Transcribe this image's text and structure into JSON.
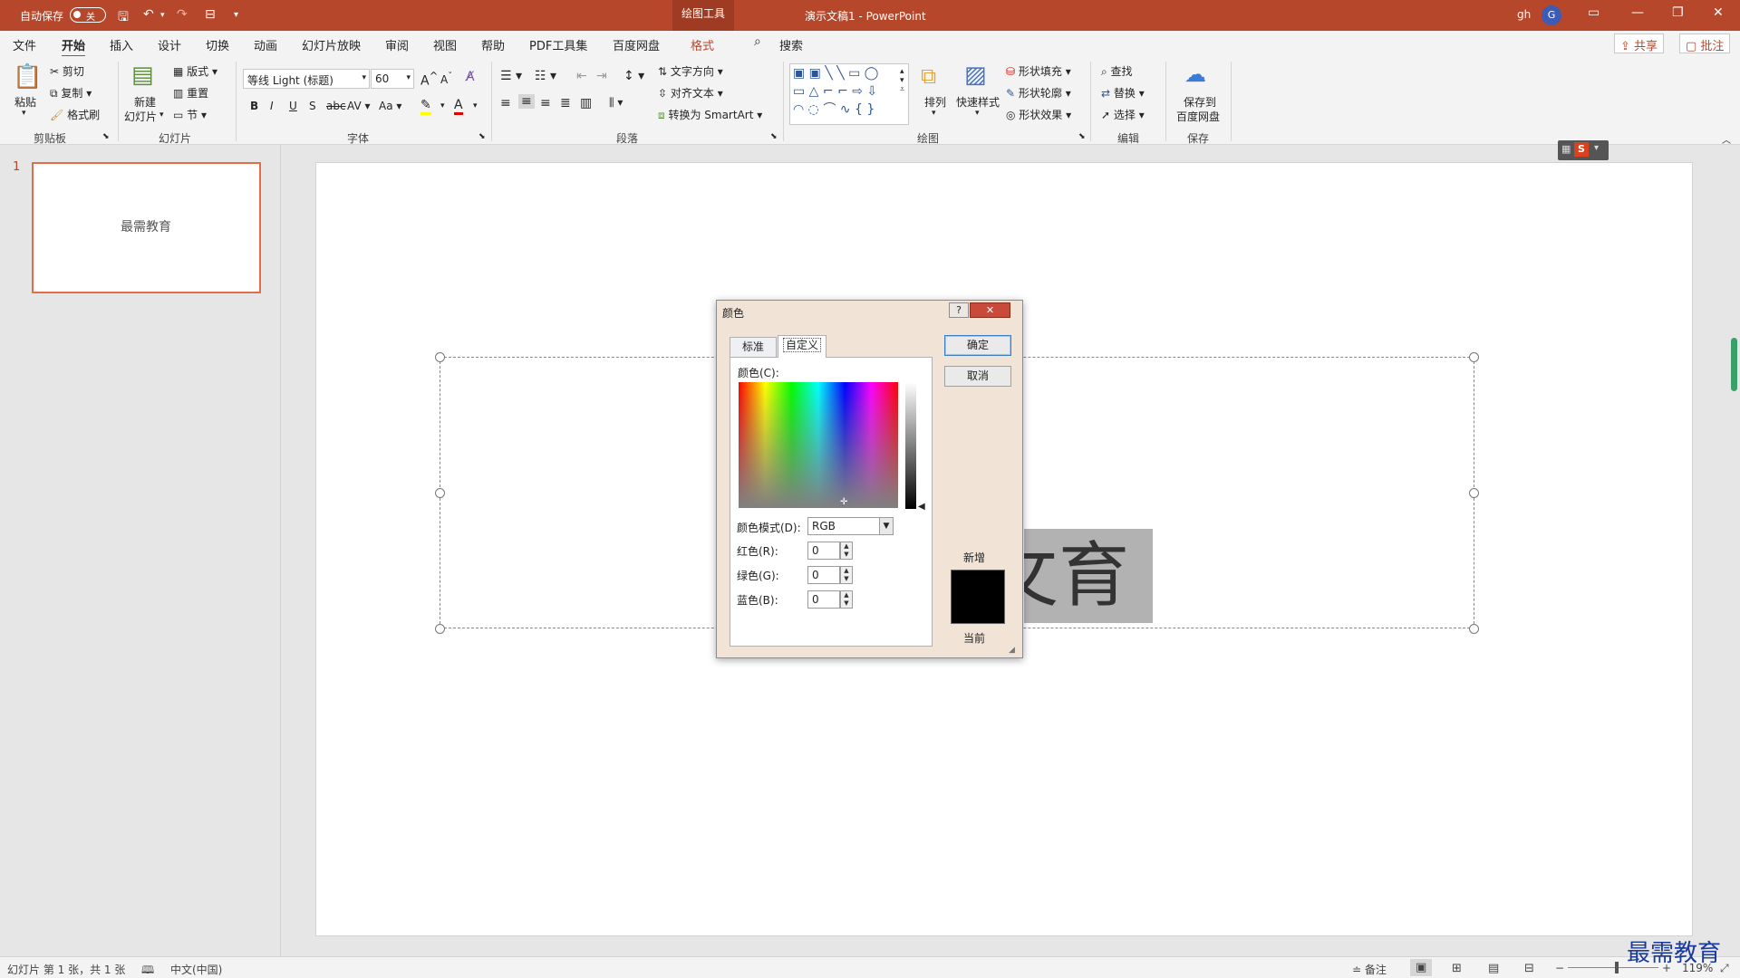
{
  "titlebar": {
    "autosave_label": "自动保存",
    "autosave_state": "关",
    "context_tab": "绘图工具",
    "doc_title": "演示文稿1 - PowerPoint",
    "user": "gh",
    "avatar_initial": "G"
  },
  "tabs": [
    "文件",
    "开始",
    "插入",
    "设计",
    "切换",
    "动画",
    "幻灯片放映",
    "审阅",
    "视图",
    "帮助",
    "PDF工具集",
    "百度网盘",
    "格式"
  ],
  "search_label": "搜索",
  "share_label": "共享",
  "comment_label": "批注",
  "ribbon": {
    "clipboard": {
      "paste": "粘贴",
      "cut": "剪切",
      "copy": "复制",
      "format_painter": "格式刷",
      "group": "剪贴板"
    },
    "slides": {
      "new_slide": "新建",
      "new_slide2": "幻灯片",
      "layout": "版式",
      "reset": "重置",
      "section": "节",
      "group": "幻灯片"
    },
    "font": {
      "name": "等线 Light (标题)",
      "size": "60",
      "group": "字体",
      "bold": "B",
      "italic": "I",
      "underline": "U",
      "shadow": "S",
      "strike": "abc",
      "spacing": "AV",
      "case": "Aa"
    },
    "paragraph": {
      "text_direction": "文字方向",
      "align_text": "对齐文本",
      "smartart": "转换为 SmartArt",
      "group": "段落"
    },
    "drawing": {
      "arrange": "排列",
      "quick_styles": "快速样式",
      "shape_fill": "形状填充",
      "shape_outline": "形状轮廓",
      "shape_effects": "形状效果",
      "group": "绘图"
    },
    "editing": {
      "find": "查找",
      "replace": "替换",
      "select": "选择",
      "group": "编辑"
    },
    "save": {
      "save_to": "保存到",
      "baidu": "百度网盘",
      "group": "保存"
    }
  },
  "thumbnail": {
    "number": "1",
    "text": "最需教育"
  },
  "slide_text": "育",
  "slide_text_prefix": "攵",
  "dialog": {
    "title": "颜色",
    "help": "?",
    "close": "✕",
    "tab_standard": "标准",
    "tab_custom": "自定义",
    "colors_label": "颜色(C):",
    "mode_label": "颜色模式(D):",
    "mode_value": "RGB",
    "red_label": "红色(R):",
    "green_label": "绿色(G):",
    "blue_label": "蓝色(B):",
    "red": "0",
    "green": "0",
    "blue": "0",
    "ok": "确定",
    "cancel": "取消",
    "new_label": "新增",
    "current_label": "当前",
    "new_color": "#000000"
  },
  "status": {
    "slide_info": "幻灯片 第 1 张，共 1 张",
    "language": "中文(中国)",
    "notes": "备注",
    "zoom": "119%"
  },
  "watermark": "最需教育",
  "colors": {
    "accent": "#b7472a",
    "dialog_bg": "#f1e4d6"
  }
}
